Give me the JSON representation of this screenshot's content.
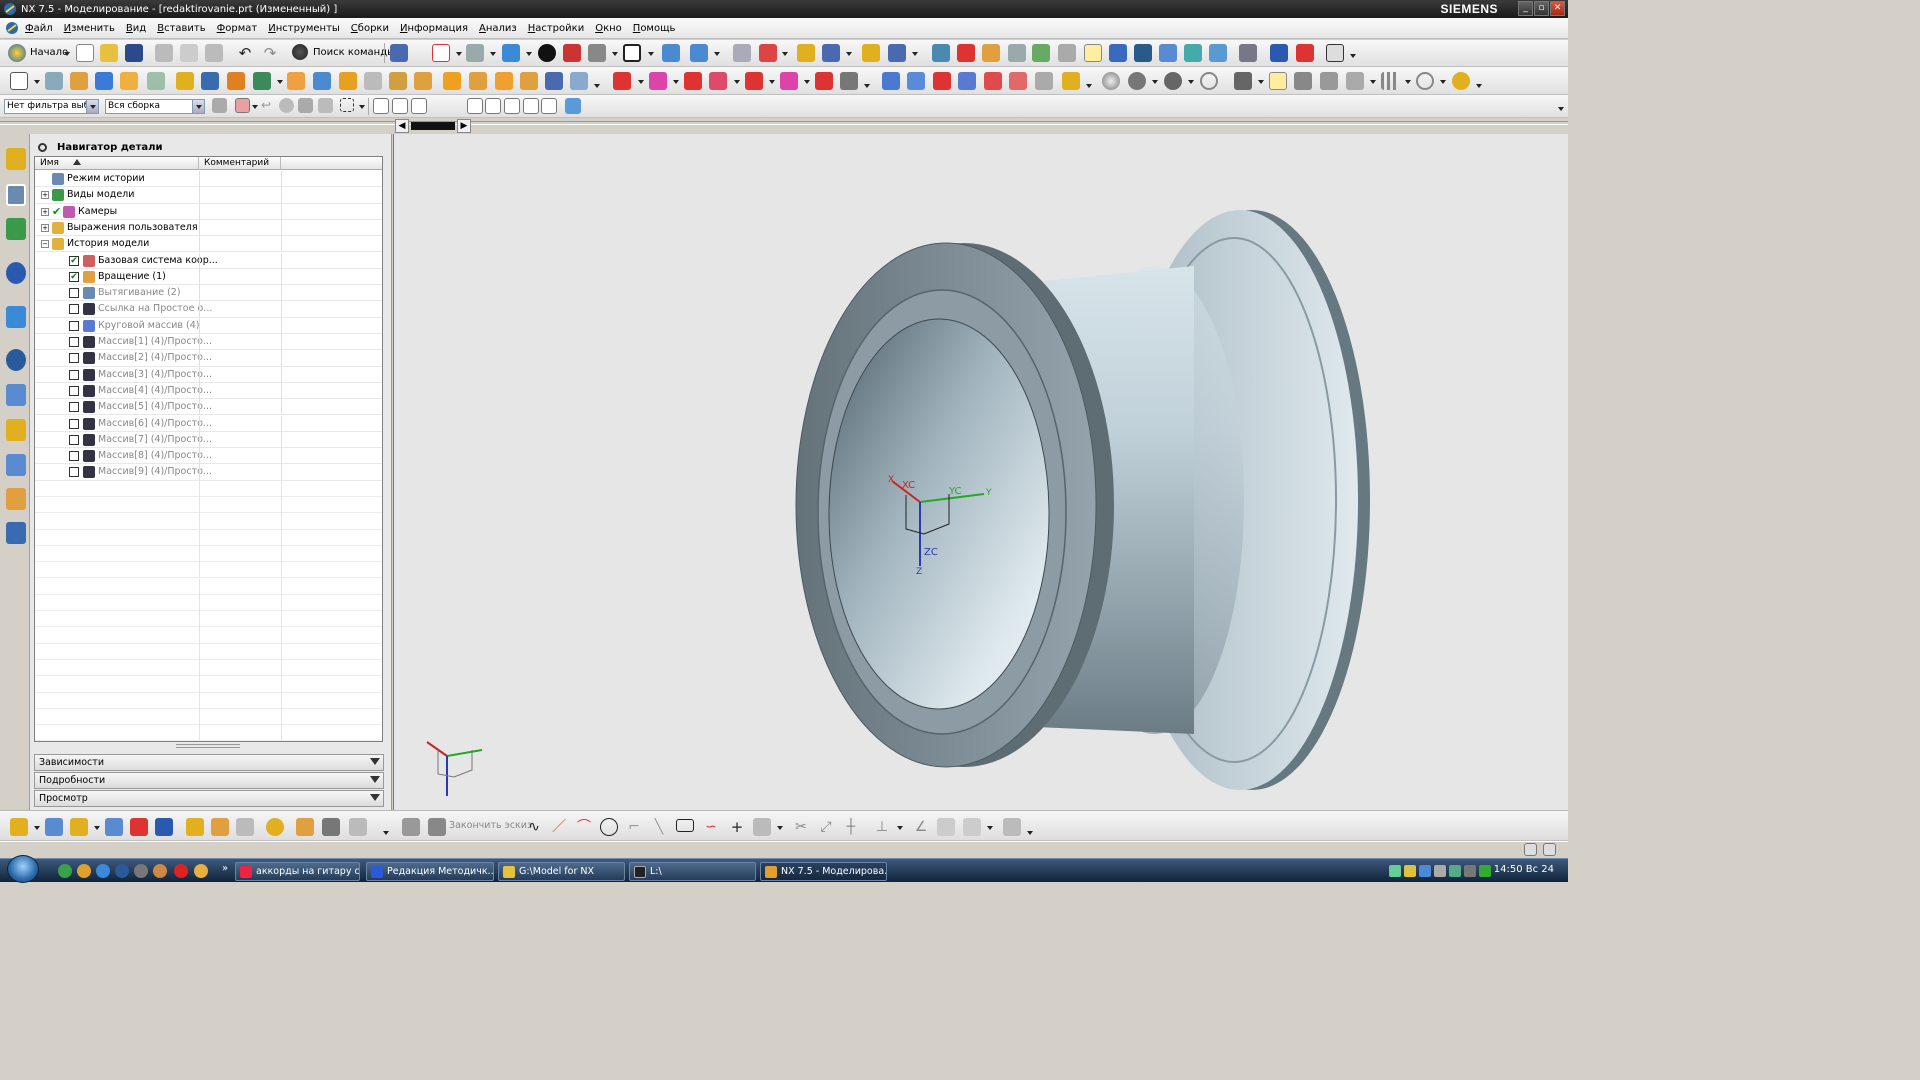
{
  "window": {
    "title": "NX 7.5 - Моделирование - [redaktirovanie.prt (Измененный) ]",
    "brand": "SIEMENS"
  },
  "menu": [
    "Файл",
    "Изменить",
    "Вид",
    "Вставить",
    "Формат",
    "Инструменты",
    "Сборки",
    "Информация",
    "Анализ",
    "Настройки",
    "Окно",
    "Помощь"
  ],
  "toolbar": {
    "start_label": "Начало",
    "command_finder_label": "Поиск команды",
    "selection_filter": "Нет фильтра выбо",
    "selection_scope": "Вся сборка"
  },
  "navigator": {
    "title": "Навигатор детали",
    "columns": [
      "Имя",
      "Комментарий"
    ],
    "rows": [
      {
        "label": "Режим истории",
        "level": 0,
        "expand": "",
        "check": "",
        "icon_color": "#6a8ab0",
        "dim": false
      },
      {
        "label": "Виды модели",
        "level": 0,
        "expand": "+",
        "check": "",
        "icon_color": "#3a9a4a",
        "dim": false
      },
      {
        "label": "Камеры",
        "level": 0,
        "expand": "+",
        "check": "✔",
        "icon_color": "#c05ab0",
        "dim": false
      },
      {
        "label": "Выражения пользователя",
        "level": 0,
        "expand": "+",
        "check": "",
        "icon_color": "#e0b040",
        "dim": false
      },
      {
        "label": "История модели",
        "level": 0,
        "expand": "−",
        "check": "",
        "icon_color": "#e0b040",
        "dim": false
      },
      {
        "label": "Базовая система коор...",
        "level": 1,
        "expand": "",
        "check": "✔",
        "icon_color": "#d06060",
        "dim": false
      },
      {
        "label": "Вращение (1)",
        "level": 1,
        "expand": "",
        "check": "✔",
        "icon_color": "#e0a040",
        "dim": false
      },
      {
        "label": "Вытягивание (2)",
        "level": 1,
        "expand": "",
        "check": "",
        "icon_color": "#6a8ab0",
        "dim": true
      },
      {
        "label": "Ссылка на Простое о...",
        "level": 1,
        "expand": "",
        "check": "",
        "icon_color": "#334",
        "dim": true
      },
      {
        "label": "Круговой массив (4)",
        "level": 1,
        "expand": "",
        "check": "",
        "icon_color": "#5a7ad0",
        "dim": true
      },
      {
        "label": "Массив[1] (4)/Просто...",
        "level": 1,
        "expand": "",
        "check": "",
        "icon_color": "#334",
        "dim": true
      },
      {
        "label": "Массив[2] (4)/Просто...",
        "level": 1,
        "expand": "",
        "check": "",
        "icon_color": "#334",
        "dim": true
      },
      {
        "label": "Массив[3] (4)/Просто...",
        "level": 1,
        "expand": "",
        "check": "",
        "icon_color": "#334",
        "dim": true
      },
      {
        "label": "Массив[4] (4)/Просто...",
        "level": 1,
        "expand": "",
        "check": "",
        "icon_color": "#334",
        "dim": true
      },
      {
        "label": "Массив[5] (4)/Просто...",
        "level": 1,
        "expand": "",
        "check": "",
        "icon_color": "#334",
        "dim": true
      },
      {
        "label": "Массив[6] (4)/Просто...",
        "level": 1,
        "expand": "",
        "check": "",
        "icon_color": "#334",
        "dim": true
      },
      {
        "label": "Массив[7] (4)/Просто...",
        "level": 1,
        "expand": "",
        "check": "",
        "icon_color": "#334",
        "dim": true
      },
      {
        "label": "Массив[8] (4)/Просто...",
        "level": 1,
        "expand": "",
        "check": "",
        "icon_color": "#334",
        "dim": true
      },
      {
        "label": "Массив[9] (4)/Просто...",
        "level": 1,
        "expand": "",
        "check": "",
        "icon_color": "#334",
        "dim": true
      }
    ],
    "sections": [
      "Зависимости",
      "Подробности",
      "Просмотр"
    ]
  },
  "graphics": {
    "wcs_labels": {
      "xc": "XC",
      "yc": "YC",
      "zc": "ZC",
      "x": "X",
      "y": "Y",
      "z": "Z"
    }
  },
  "sketch": {
    "finish_label": "Закончить эскиз"
  },
  "taskbar": {
    "tasks": [
      {
        "label": "аккорды на гитару с...",
        "icon_color": "#e24",
        "active": false
      },
      {
        "label": "Редакция Методичк...",
        "icon_color": "#2a5ad8",
        "active": false
      },
      {
        "label": "G:\\Model for NX",
        "icon_color": "#e8c040",
        "active": false
      },
      {
        "label": "L:\\",
        "icon_color": "#222",
        "active": false
      },
      {
        "label": "NX 7.5 - Моделирова...",
        "icon_color": "#e0a030",
        "active": true
      }
    ],
    "clock": "14:50 Вс 24"
  }
}
